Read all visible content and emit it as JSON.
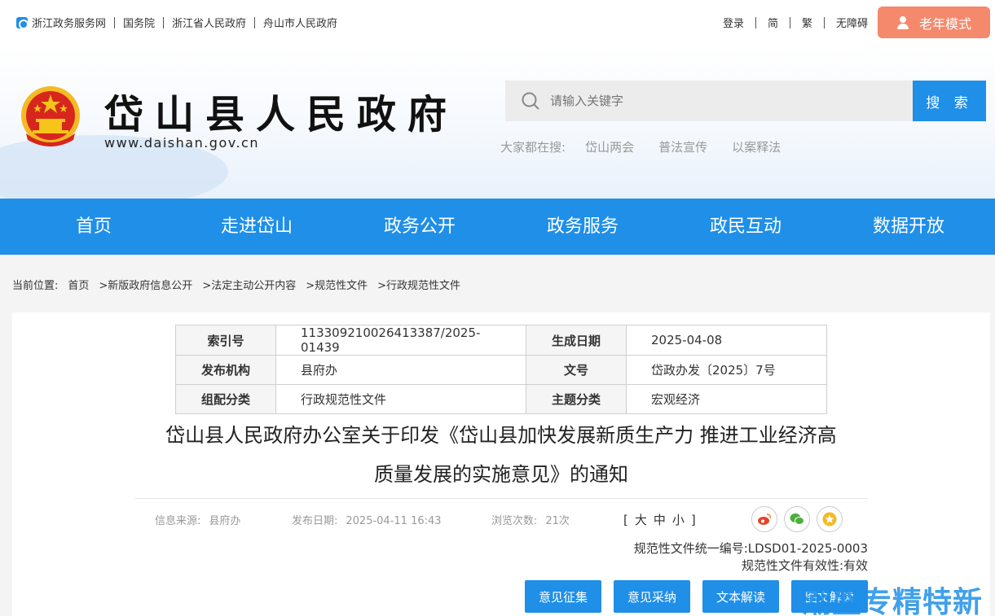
{
  "topbar": {
    "links": [
      "浙江政务服务网",
      "国务院",
      "浙江省人民政府",
      "舟山市人民政府"
    ],
    "right_links": [
      "登录",
      "简",
      "繁",
      "无障碍"
    ],
    "elder_mode": "老年模式"
  },
  "header": {
    "title": "岱山县人民政府",
    "url": "www.daishan.gov.cn",
    "search_placeholder": "请输入关键字",
    "search_button": "搜 索",
    "hot_label": "大家都在搜:",
    "hot_keywords": [
      "岱山两会",
      "普法宣传",
      "以案释法"
    ]
  },
  "nav": [
    "首页",
    "走进岱山",
    "政务公开",
    "政务服务",
    "政民互动",
    "数据开放"
  ],
  "breadcrumb": {
    "label": "当前位置:",
    "items": [
      "首页",
      ">新版政府信息公开",
      ">法定主动公开内容",
      ">规范性文件",
      ">行政规范性文件"
    ]
  },
  "meta": {
    "rows": [
      [
        "索引号",
        "113309210026413387/2025-01439",
        "生成日期",
        "2025-04-08"
      ],
      [
        "发布机构",
        "县府办",
        "文号",
        "岱政办发〔2025〕7号"
      ],
      [
        "组配分类",
        "行政规范性文件",
        "主题分类",
        "宏观经济"
      ]
    ]
  },
  "document": {
    "title_line1": "岱山县人民政府办公室关于印发《岱山县加快发展新质生产力 推进工业经济高",
    "title_line2": "质量发展的实施意见》的通知",
    "source_label": "信息来源:",
    "source": "县府办",
    "date_label": "发布日期:",
    "date": "2025-04-11 16:43",
    "views_label": "浏览次数:",
    "views": "21次",
    "font_size": "[大中小]",
    "spec_number": "规范性文件统一编号:LDSD01-2025-0003",
    "spec_validity": "规范性文件有效性:有效"
  },
  "actions": [
    "意见征集",
    "意见采纳",
    "文本解读",
    "图文解读"
  ],
  "watermark": "潮盛专精特新",
  "colors": {
    "primary": "#1f8fe8",
    "elder": "#f4896c"
  }
}
